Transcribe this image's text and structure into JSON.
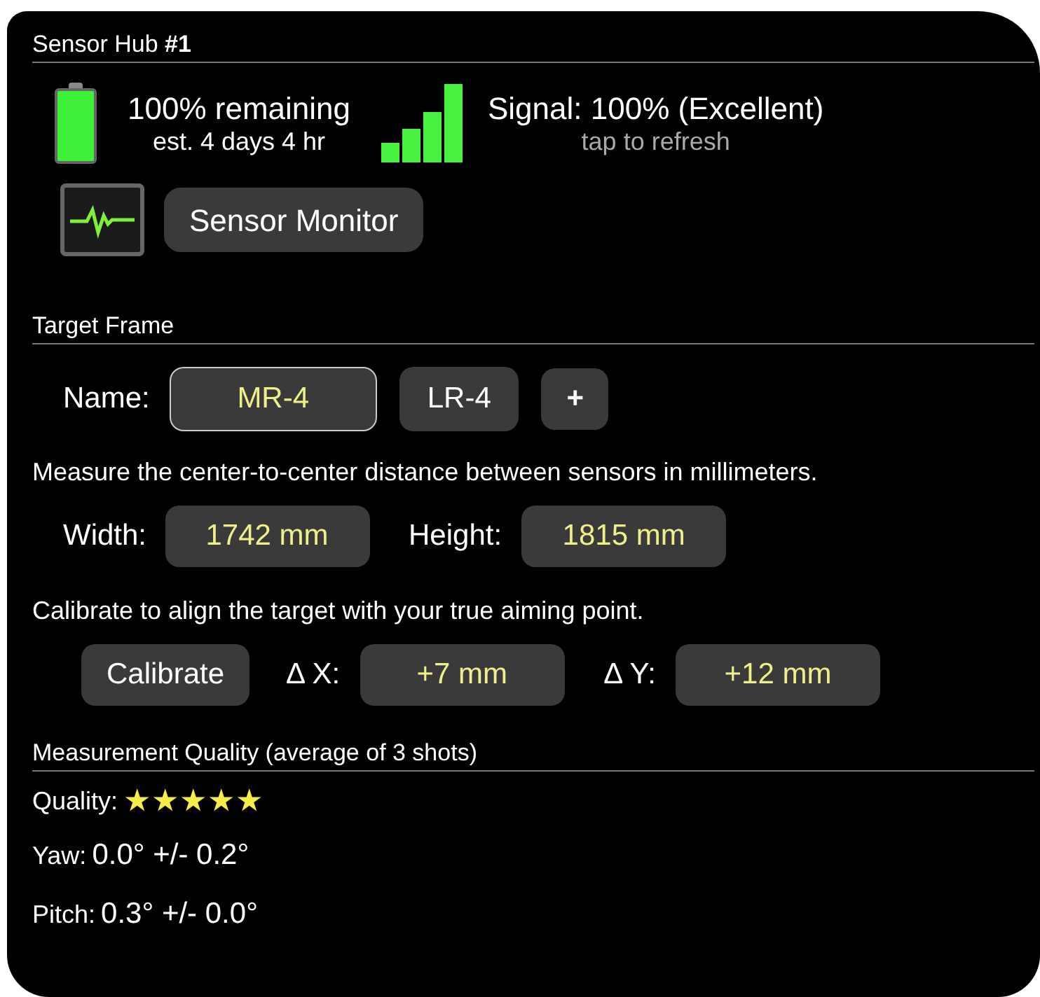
{
  "title": "Sensor Hub **#1**",
  "battery": {
    "remaining": "100% remaining",
    "estimate": "est. 4 days 4 hr"
  },
  "signal": {
    "status": "Signal: 100% (Excellent)",
    "hint": "tap to refresh"
  },
  "monitor_button": "Sensor Monitor",
  "target_frame": {
    "heading": "Target Frame",
    "name_label": "Name:",
    "frames": [
      {
        "label": "MR-4",
        "selected": true
      },
      {
        "label": "LR-4",
        "selected": false
      }
    ],
    "add_button": "+",
    "measure_hint": "Measure the center-to-center distance between sensors in millimeters.",
    "width_label": "Width:",
    "width_value": "1742 mm",
    "height_label": "Height:",
    "height_value": "1815 mm",
    "calibrate_hint": "Calibrate to align the target with your true aiming point.",
    "calibrate_button": "Calibrate",
    "dx_label": "Δ X:",
    "dx_value": "+7 mm",
    "dy_label": "Δ Y:",
    "dy_value": "+12 mm"
  },
  "quality": {
    "heading": "Measurement Quality (average of 3 shots)",
    "quality_label": "Quality:",
    "stars": 5,
    "yaw_label": "Yaw:",
    "yaw_value": "0.0° +/- 0.2°",
    "pitch_label": "Pitch:",
    "pitch_value": "0.3° +/- 0.0°"
  }
}
